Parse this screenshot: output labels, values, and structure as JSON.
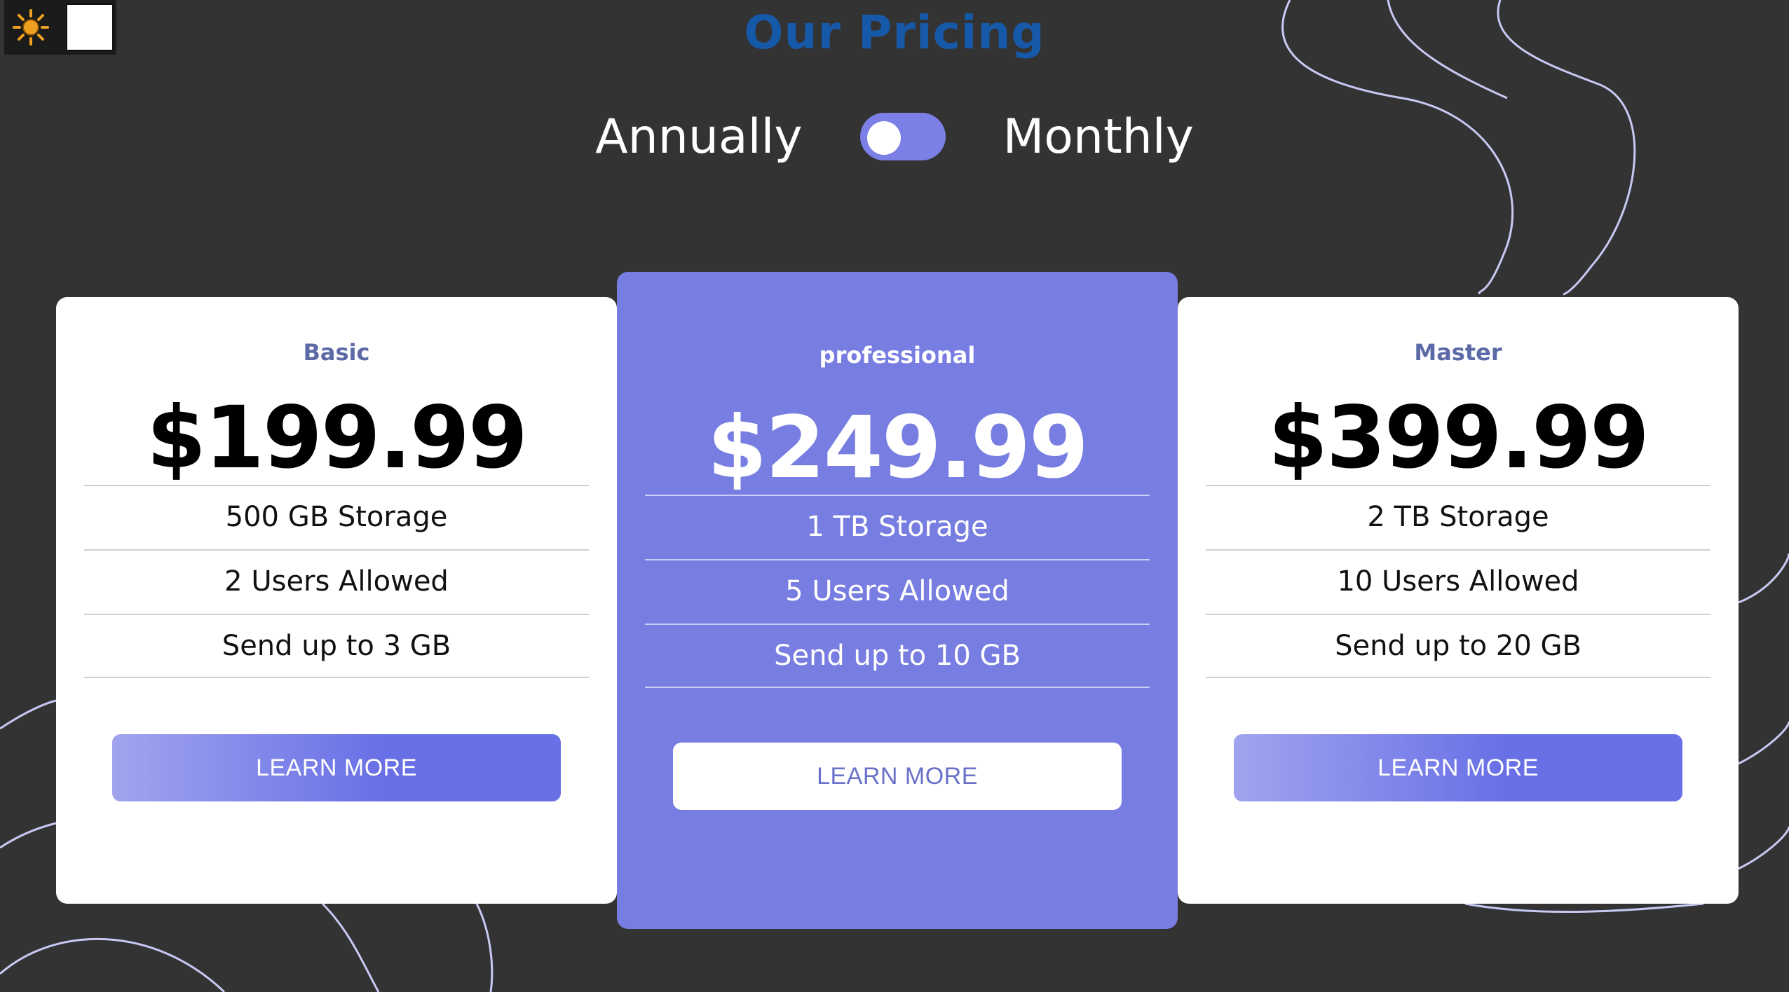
{
  "theme_widget": {
    "sun_icon": "sun-icon",
    "swatch_color": "#ffffff"
  },
  "header": {
    "title": "Our Pricing"
  },
  "billing_toggle": {
    "left_label": "Annually",
    "right_label": "Monthly",
    "selected": "Annually"
  },
  "colors": {
    "background": "#333333",
    "title": "#1659a8",
    "accent": "#777de1",
    "button_gradient_start": "#a0a4ee",
    "button_gradient_end": "#6970e6"
  },
  "plans": [
    {
      "name": "Basic",
      "price": "$199.99",
      "features": [
        "500 GB Storage",
        "2 Users Allowed",
        "Send up to 3 GB"
      ],
      "cta": "LEARN MORE"
    },
    {
      "name": "professional",
      "price": "$249.99",
      "features": [
        "1 TB Storage",
        "5 Users Allowed",
        "Send up to 10 GB"
      ],
      "cta": "LEARN MORE"
    },
    {
      "name": "Master",
      "price": "$399.99",
      "features": [
        "2 TB Storage",
        "10 Users Allowed",
        "Send up to 20 GB"
      ],
      "cta": "LEARN MORE"
    }
  ]
}
